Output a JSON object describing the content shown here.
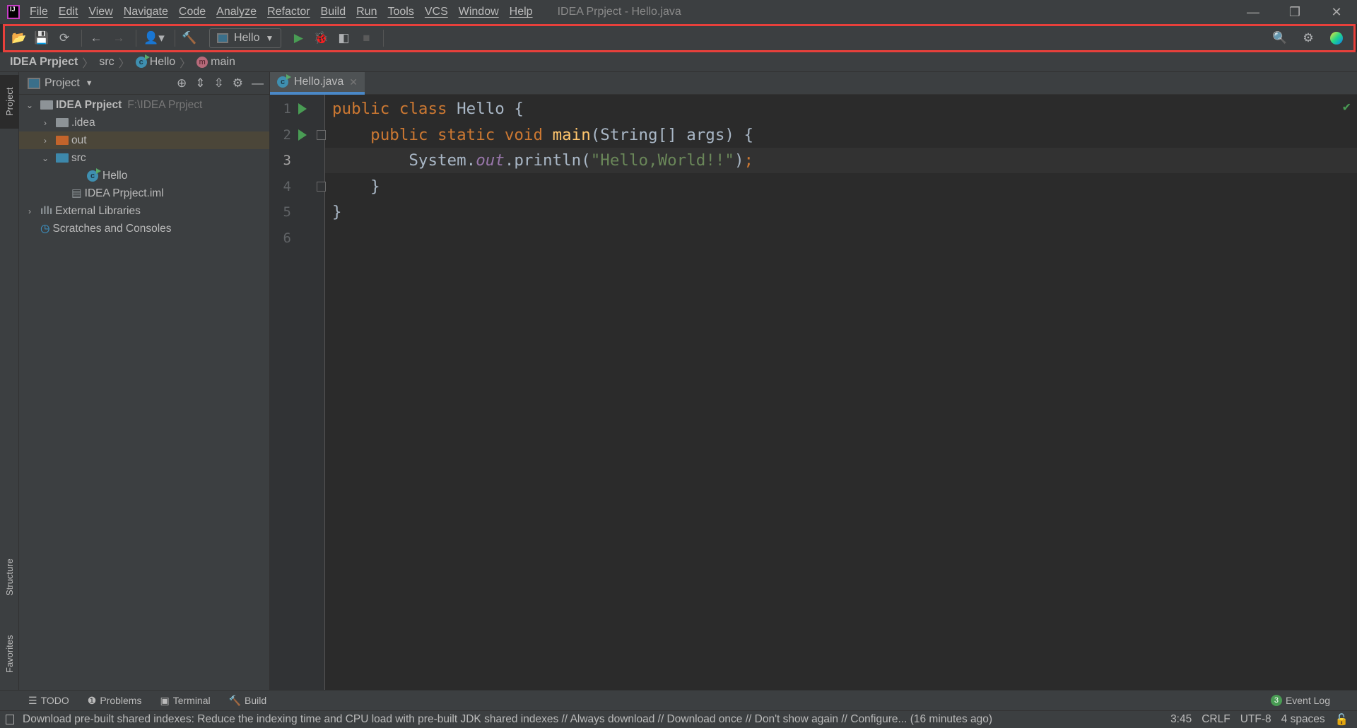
{
  "window": {
    "title": "IDEA Prpject - Hello.java",
    "menu": [
      "File",
      "Edit",
      "View",
      "Navigate",
      "Code",
      "Analyze",
      "Refactor",
      "Build",
      "Run",
      "Tools",
      "VCS",
      "Window",
      "Help"
    ],
    "controls": {
      "minimize": "—",
      "restore": "❐",
      "close": "✕"
    }
  },
  "toolbar": {
    "run_config": "Hello",
    "highlight_color": "#e8403b"
  },
  "breadcrumb": [
    "IDEA Prpject",
    "src",
    "Hello",
    "main"
  ],
  "project_panel": {
    "title": "Project",
    "tree": [
      {
        "label": "IDEA Prpject",
        "hint": "F:\\IDEA Prpject",
        "expanded": true,
        "icon": "project-folder-icon"
      },
      {
        "label": ".idea",
        "expanded": false,
        "icon": "folder-icon"
      },
      {
        "label": "out",
        "expanded": false,
        "icon": "excluded-folder-icon",
        "selected": true
      },
      {
        "label": "src",
        "expanded": true,
        "icon": "source-folder-icon"
      },
      {
        "label": "Hello",
        "icon": "java-class-icon"
      },
      {
        "label": "IDEA Prpject.iml",
        "icon": "module-file-icon"
      },
      {
        "label": "External Libraries",
        "expanded": false,
        "icon": "libraries-icon"
      },
      {
        "label": "Scratches and Consoles",
        "icon": "scratches-icon"
      }
    ]
  },
  "side_tabs": {
    "project": "Project",
    "structure": "Structure",
    "favorites": "Favorites"
  },
  "editor": {
    "tab": "Hello.java",
    "current_line": 3,
    "lines": [
      [
        {
          "t": "public class ",
          "c": "kw"
        },
        {
          "t": "Hello {",
          "c": ""
        }
      ],
      [
        {
          "t": "    public static void ",
          "c": "kw"
        },
        {
          "t": "main",
          "c": "fn"
        },
        {
          "t": "(String[] args) {",
          "c": ""
        }
      ],
      [
        {
          "t": "        System.",
          "c": ""
        },
        {
          "t": "out",
          "c": "fld"
        },
        {
          "t": ".println(",
          "c": ""
        },
        {
          "t": "\"Hello,World!!\"",
          "c": "st"
        },
        {
          "t": ")",
          "c": ""
        },
        {
          "t": ";",
          "c": "kw"
        }
      ],
      [
        {
          "t": "    }",
          "c": ""
        }
      ],
      [
        {
          "t": "}",
          "c": ""
        }
      ],
      []
    ]
  },
  "bottom_tools": {
    "todo": "TODO",
    "problems": "Problems",
    "terminal": "Terminal",
    "build": "Build",
    "event_log": "Event Log",
    "event_count": "3"
  },
  "status": {
    "message": "Download pre-built shared indexes: Reduce the indexing time and CPU load with pre-built JDK shared indexes // Always download // Download once // Don't show again // Configure... (16 minutes ago)",
    "position": "3:45",
    "line_sep": "CRLF",
    "encoding": "UTF-8",
    "indent": "4 spaces"
  }
}
